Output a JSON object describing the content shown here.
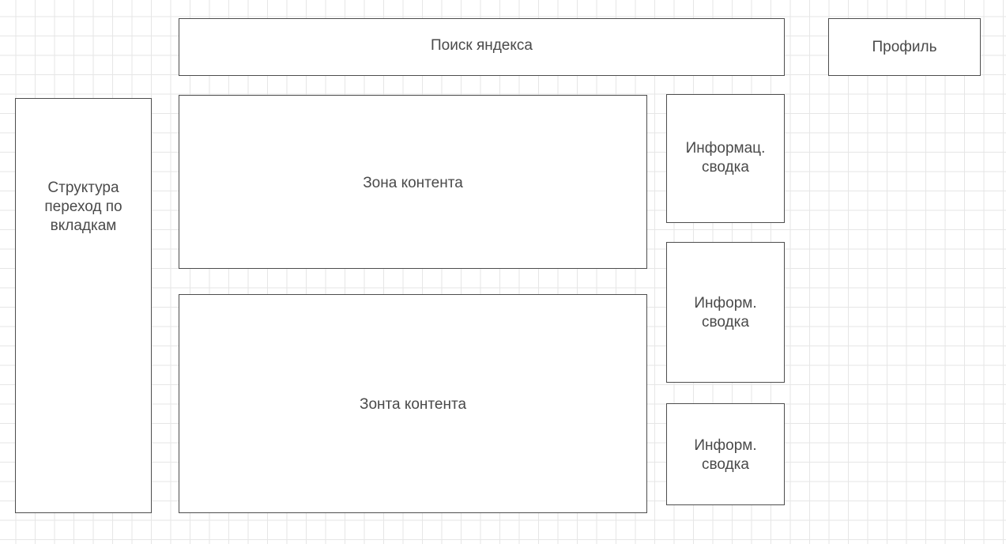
{
  "header": {
    "search_label": "Поиск яндекса",
    "profile_label": "Профиль"
  },
  "sidebar": {
    "structure_label": "Структура\nпереход по\nвкладкам"
  },
  "main": {
    "content_zone_1": "Зона контента",
    "content_zone_2": "Зонта контента"
  },
  "info_panels": [
    {
      "label": "Информац.\nсводка"
    },
    {
      "label": "Информ.\nсводка"
    },
    {
      "label": "Информ.\nсводка"
    }
  ]
}
